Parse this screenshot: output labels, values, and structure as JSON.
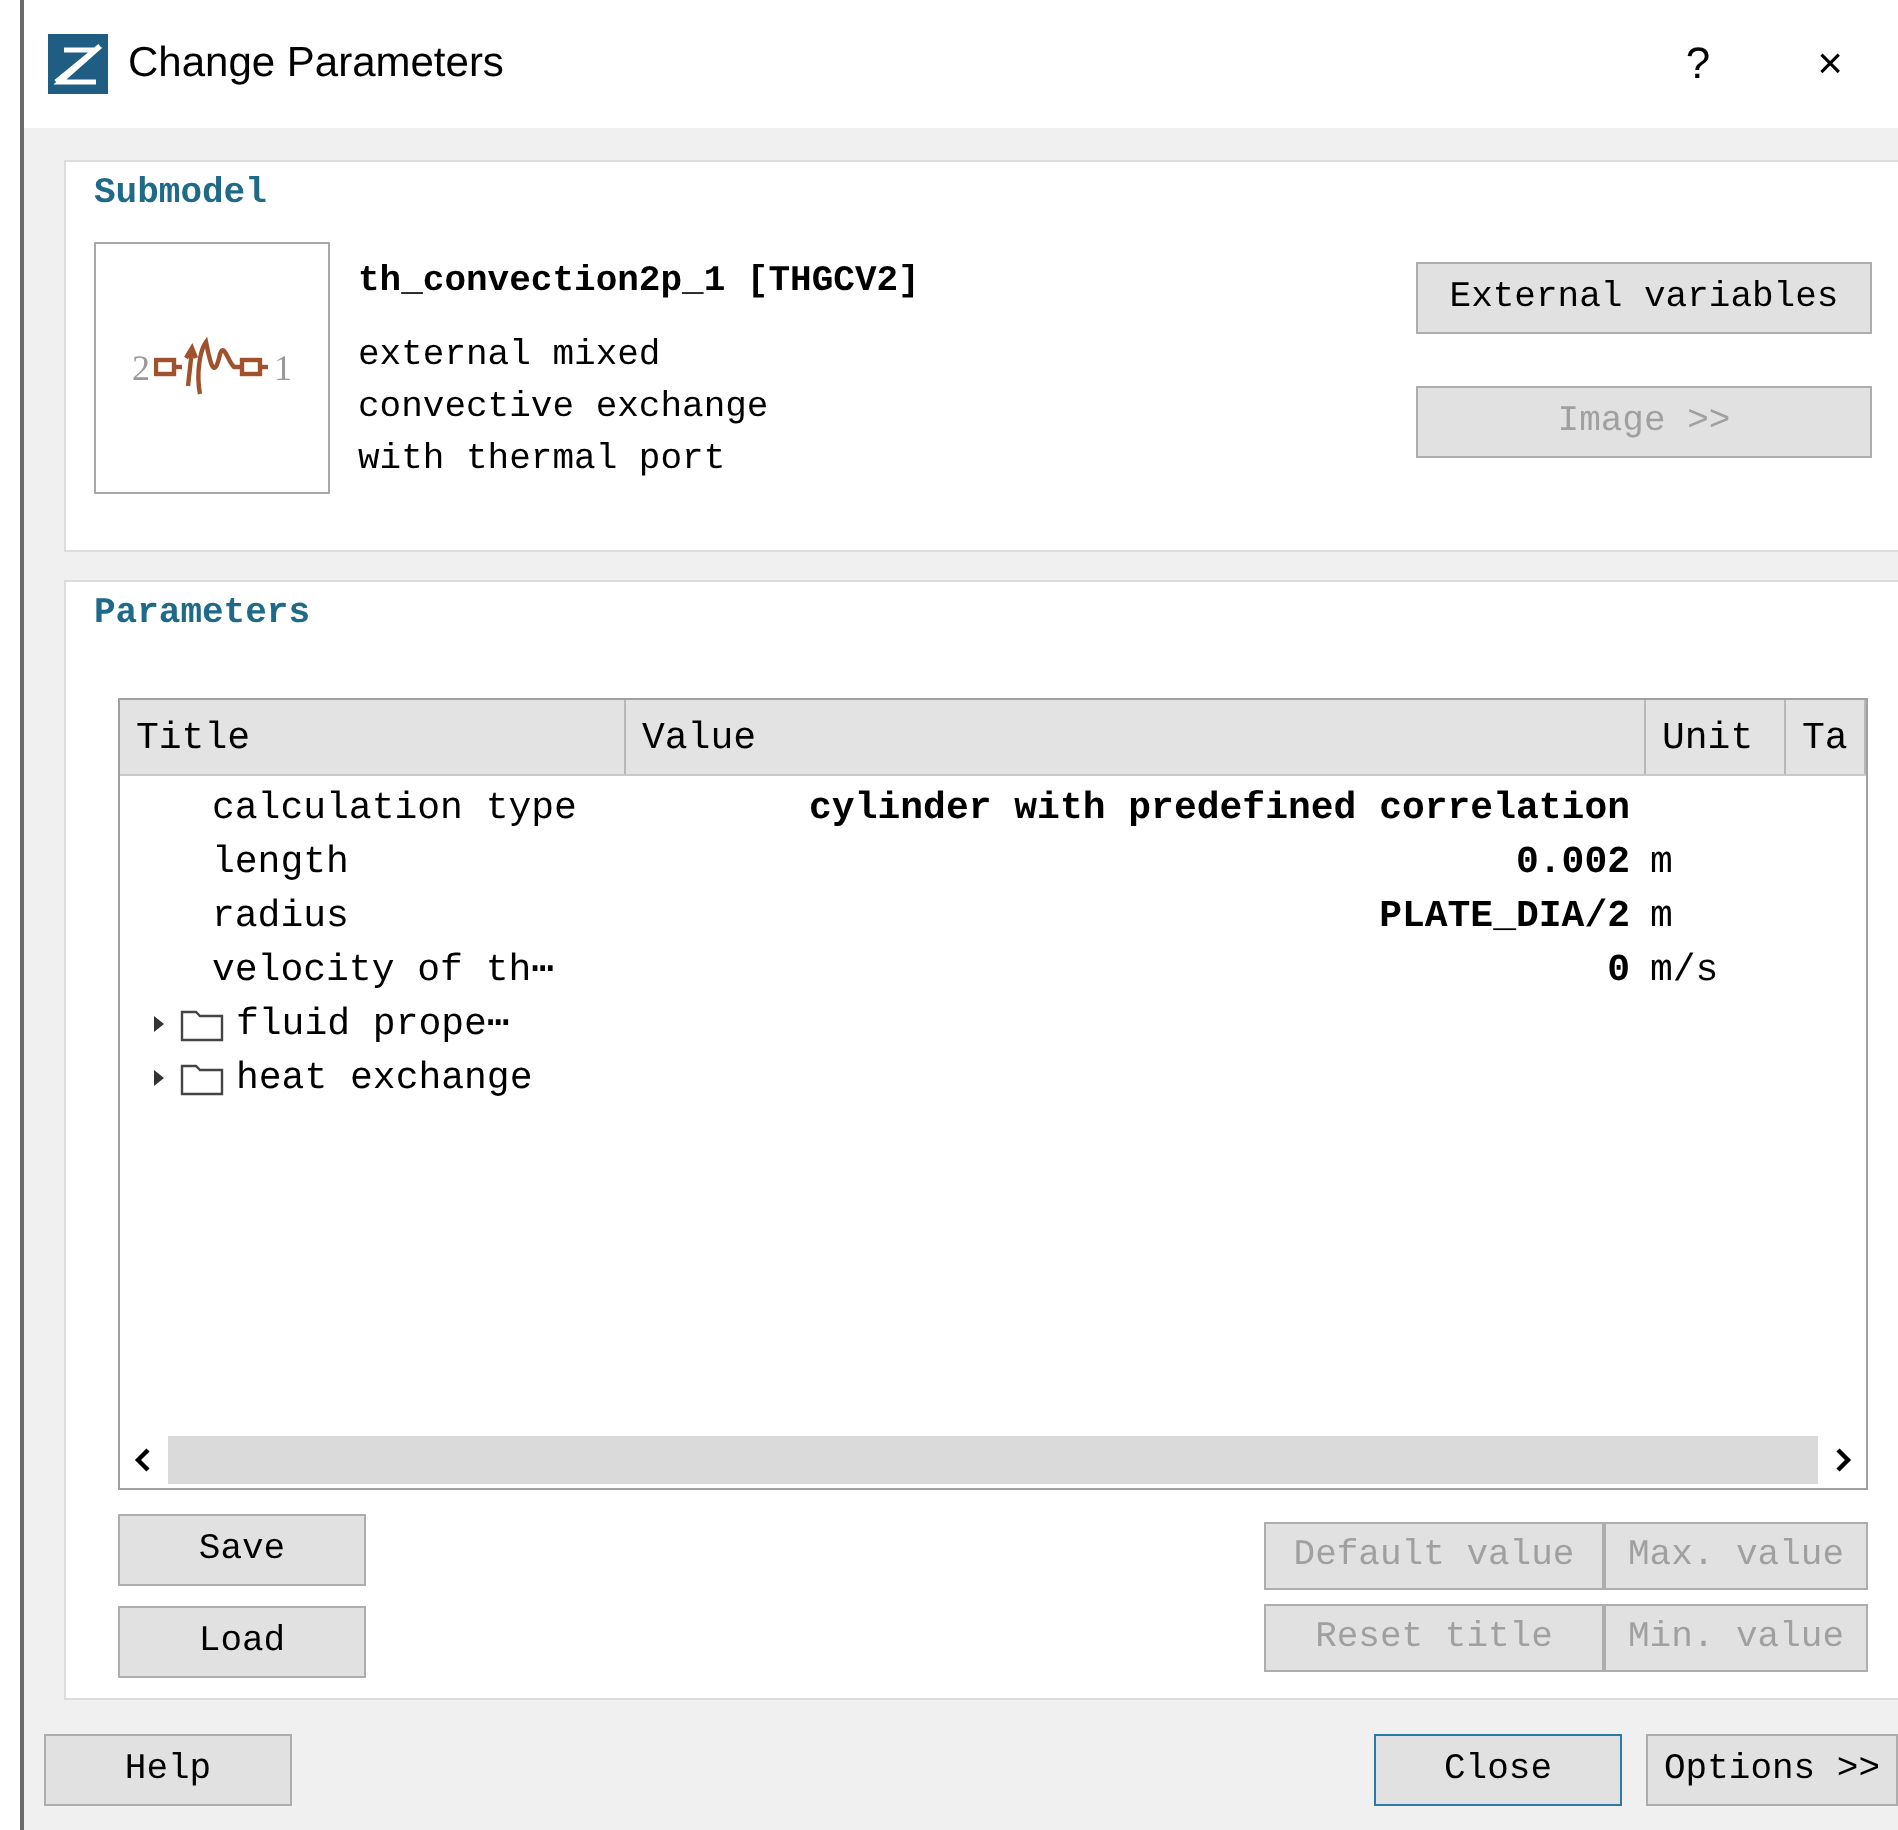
{
  "window": {
    "title": "Change Parameters",
    "help": "?",
    "close": "×"
  },
  "submodel": {
    "heading": "Submodel",
    "icon_labels": [
      "2",
      "1"
    ],
    "name": "th_convection2p_1 [THGCV2]",
    "description": [
      "external mixed",
      "convective exchange",
      "with thermal port"
    ],
    "buttons": [
      {
        "label": "External variables",
        "disabled": false
      },
      {
        "label": "Image >>",
        "disabled": true
      }
    ]
  },
  "parameters": {
    "heading": "Parameters",
    "columns": [
      "Title",
      "Value",
      "Unit",
      "Ta"
    ],
    "rows": [
      {
        "kind": "param",
        "title": "calculation type",
        "value": "cylinder with predefined correlation"
      },
      {
        "kind": "param",
        "title": "length",
        "value": "0.002",
        "unit": "m"
      },
      {
        "kind": "param",
        "title": "radius",
        "value": "PLATE_DIA/2",
        "unit": "m"
      },
      {
        "kind": "param",
        "title": "velocity of th⋯",
        "value": "0",
        "unit": "m/s"
      },
      {
        "kind": "folder",
        "title": "fluid prope⋯",
        "expanded": false
      },
      {
        "kind": "folder",
        "title": "heat exchange",
        "expanded": false
      }
    ],
    "left_buttons": [
      {
        "label": "Save",
        "disabled": false
      },
      {
        "label": "Load",
        "disabled": false
      }
    ],
    "right_buttons": [
      {
        "label": "Default value",
        "disabled": true
      },
      {
        "label": "Max. value",
        "disabled": true
      },
      {
        "label": "Reset title",
        "disabled": true
      },
      {
        "label": "Min. value",
        "disabled": true
      }
    ]
  },
  "footer": {
    "buttons": [
      {
        "label": "Help",
        "default": false
      },
      {
        "label": "Close",
        "default": true
      },
      {
        "label": "Options >>",
        "default": false
      }
    ]
  }
}
